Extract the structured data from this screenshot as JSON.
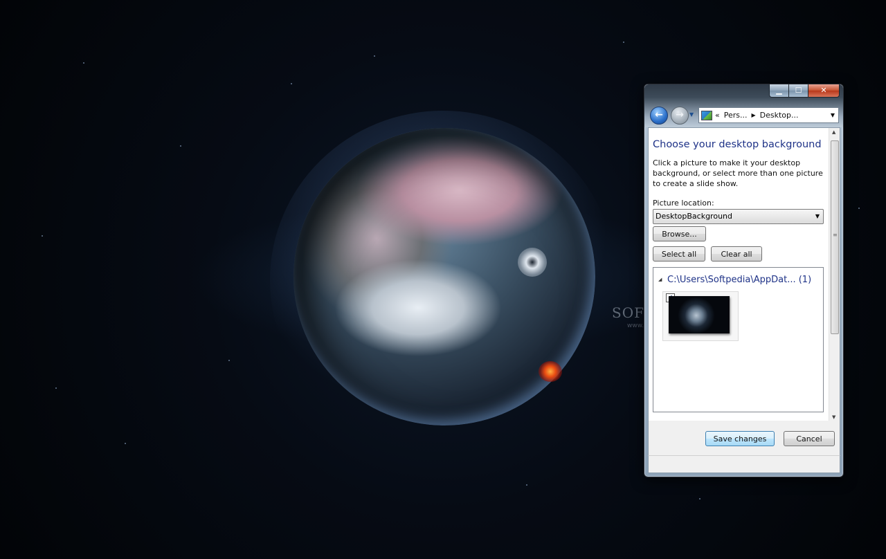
{
  "window": {
    "caption_buttons": {
      "minimize": "▁",
      "maximize": "☐",
      "close": "✕"
    }
  },
  "navigation": {
    "back_icon": "back-arrow-icon",
    "forward_icon": "forward-arrow-icon",
    "address": {
      "overflow": "«",
      "segments": [
        "Pers...",
        "Desktop..."
      ]
    }
  },
  "content": {
    "title": "Choose your desktop background",
    "instructions": "Click a picture to make it your desktop background, or select more than one picture to create a slide show.",
    "picture_location_label": "Picture location:",
    "picture_location_value": "DesktopBackground",
    "browse_label": "Browse...",
    "select_all_label": "Select all",
    "clear_all_label": "Clear all",
    "group_header": "C:\\Users\\Softpedia\\AppDat... (1)",
    "thumbnail_checked": true
  },
  "footer": {
    "save_label": "Save changes",
    "cancel_label": "Cancel"
  },
  "desktop": {
    "watermark": "SOFTPEDIA",
    "watermark_sub": "www.softpedia.com"
  },
  "colors": {
    "title_blue": "#1e3287",
    "close_red": "#c5512f",
    "default_button_blue": "#3c7fb1"
  }
}
